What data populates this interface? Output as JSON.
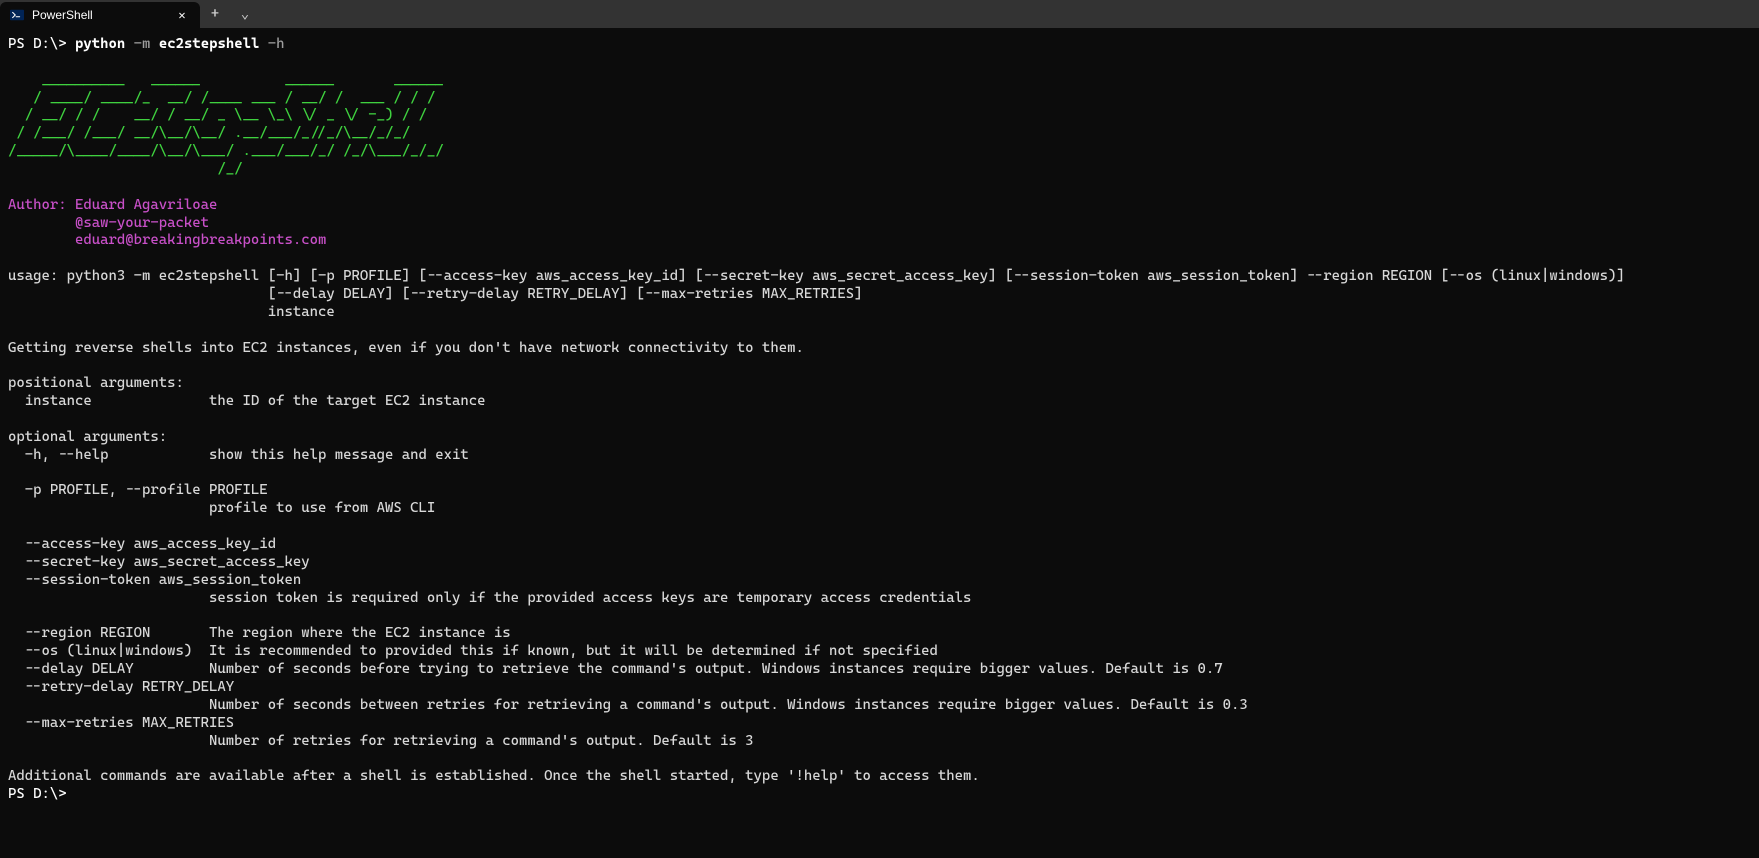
{
  "titlebar": {
    "tab_title": "PowerShell",
    "new_tab": "+",
    "dropdown": "⌄",
    "close": "✕"
  },
  "terminal": {
    "prompt1_ps": "PS ",
    "prompt1_path": "D:\\> ",
    "cmd_python": "python",
    "cmd_m": " -m",
    "cmd_module": " ec2stepshell",
    "cmd_h": " -h",
    "ascii_line1": "    __________   ______          ______       ______",
    "ascii_line2": "   / ____/ ____/_  __/ /____ ___ / __/ /  ___ / / /",
    "ascii_line3": "  / __/ / /    __/ / __/ _ \\__ \\_\\ \\/ _ \\/ -_) / /",
    "ascii_line4": " / /___/ /___/ __/\\__/\\__/ .__/___/_//_/\\__/_/_/",
    "ascii_line5": "/_____/\\____/____/\\__/\\___/ .___/___/_/ /_/\\___/_/_/",
    "ascii_line6": "                         /_/",
    "author_line1": "Author: Eduard Agavriloae",
    "author_line2": "        @saw-your-packet",
    "author_line3": "        eduard@breakingbreakpoints.com",
    "usage_line1": "usage: python3 -m ec2stepshell [-h] [-p PROFILE] [--access-key aws_access_key_id] [--secret-key aws_secret_access_key] [--session-token aws_session_token] --region REGION [--os (linux|windows)]",
    "usage_line2": "                               [--delay DELAY] [--retry-delay RETRY_DELAY] [--max-retries MAX_RETRIES]",
    "usage_line3": "                               instance",
    "desc": "Getting reverse shells into EC2 instances, even if you don't have network connectivity to them.",
    "pos_header": "positional arguments:",
    "pos_instance": "  instance              the ID of the target EC2 instance",
    "opt_header": "optional arguments:",
    "opt_help": "  -h, --help            show this help message and exit",
    "opt_profile1": "  -p PROFILE, --profile PROFILE",
    "opt_profile2": "                        profile to use from AWS CLI",
    "opt_access": "  --access-key aws_access_key_id",
    "opt_secret": "  --secret-key aws_secret_access_key",
    "opt_session1": "  --session-token aws_session_token",
    "opt_session2": "                        session token is required only if the provided access keys are temporary access credentials",
    "opt_region": "  --region REGION       The region where the EC2 instance is",
    "opt_os": "  --os (linux|windows)  It is recommended to provided this if known, but it will be determined if not specified",
    "opt_delay": "  --delay DELAY         Number of seconds before trying to retrieve the command's output. Windows instances require bigger values. Default is 0.7",
    "opt_retry1": "  --retry-delay RETRY_DELAY",
    "opt_retry2": "                        Number of seconds between retries for retrieving a command's output. Windows instances require bigger values. Default is 0.3",
    "opt_max1": "  --max-retries MAX_RETRIES",
    "opt_max2": "                        Number of retries for retrieving a command's output. Default is 3",
    "additional": "Additional commands are available after a shell is established. Once the shell started, type '!help' to access them.",
    "prompt2_ps": "PS ",
    "prompt2_path": "D:\\>"
  }
}
